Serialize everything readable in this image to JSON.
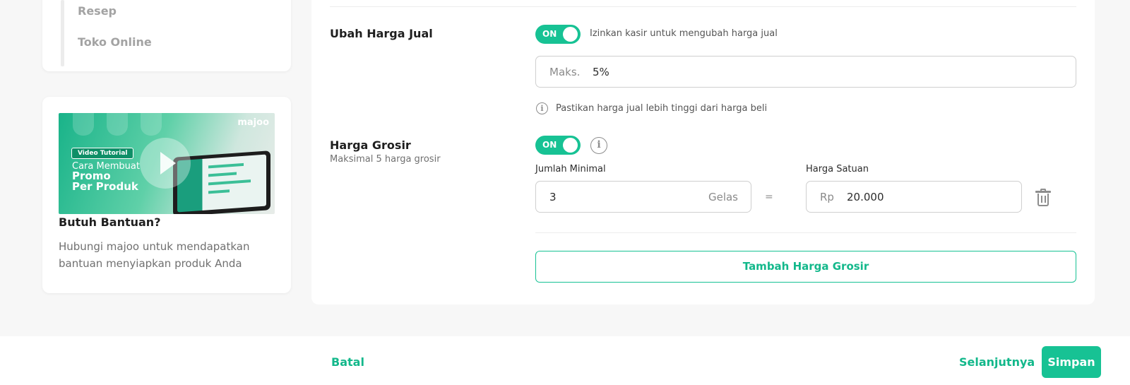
{
  "sidebar": {
    "nav_items": [
      "Resep",
      "Toko Online"
    ],
    "help": {
      "video_badge": "Video Tutorial",
      "video_line1": "Cara Membuat",
      "video_line2": "Promo",
      "video_line3": "Per Produk",
      "video_brand": "majoo",
      "title": "Butuh Bantuan?",
      "description": "Hubungi majoo untuk mendapatkan bantuan menyiapkan produk Anda"
    }
  },
  "form": {
    "ubah_harga_jual": {
      "label": "Ubah Harga Jual",
      "toggle": "ON",
      "toggle_desc": "Izinkan kasir untuk mengubah harga jual",
      "max_prefix": "Maks.",
      "max_value": "5%",
      "hint": "Pastikan harga jual lebih tinggi dari harga beli"
    },
    "harga_grosir": {
      "label": "Harga Grosir",
      "sublabel": "Maksimal 5 harga grosir",
      "toggle": "ON",
      "qty_label": "Jumlah Minimal",
      "qty_value": "3",
      "qty_unit": "Gelas",
      "equals": "=",
      "price_label": "Harga Satuan",
      "price_prefix": "Rp",
      "price_value": "20.000",
      "add_button": "Tambah Harga Grosir"
    }
  },
  "footer": {
    "cancel": "Batal",
    "next": "Selanjutnya",
    "save": "Simpan"
  },
  "colors": {
    "accent": "#17c294",
    "accent_text": "#13b88b"
  }
}
